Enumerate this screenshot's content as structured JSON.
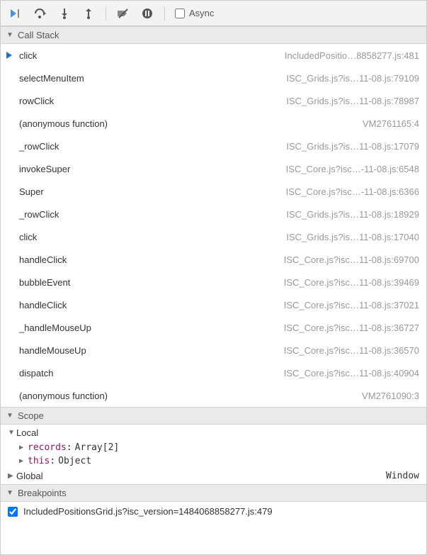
{
  "toolbar": {
    "async_label": "Async",
    "async_checked": false
  },
  "sections": {
    "callstack_title": "Call Stack",
    "scope_title": "Scope",
    "breakpoints_title": "Breakpoints"
  },
  "callstack": [
    {
      "func": "click",
      "loc": "IncludedPositio…8858277.js:481",
      "active": true
    },
    {
      "func": "selectMenuItem",
      "loc": "ISC_Grids.js?is…11-08.js:79109"
    },
    {
      "func": "rowClick",
      "loc": "ISC_Grids.js?is…11-08.js:78987"
    },
    {
      "func": "(anonymous function)",
      "loc": "VM2761165:4"
    },
    {
      "func": "_rowClick",
      "loc": "ISC_Grids.js?is…11-08.js:17079"
    },
    {
      "func": "invokeSuper",
      "loc": "ISC_Core.js?isc…-11-08.js:6548"
    },
    {
      "func": "Super",
      "loc": "ISC_Core.js?isc…-11-08.js:6366"
    },
    {
      "func": "_rowClick",
      "loc": "ISC_Grids.js?is…11-08.js:18929"
    },
    {
      "func": "click",
      "loc": "ISC_Grids.js?is…11-08.js:17040"
    },
    {
      "func": "handleClick",
      "loc": "ISC_Core.js?isc…11-08.js:69700"
    },
    {
      "func": "bubbleEvent",
      "loc": "ISC_Core.js?isc…11-08.js:39469"
    },
    {
      "func": "handleClick",
      "loc": "ISC_Core.js?isc…11-08.js:37021"
    },
    {
      "func": "_handleMouseUp",
      "loc": "ISC_Core.js?isc…11-08.js:36727"
    },
    {
      "func": "handleMouseUp",
      "loc": "ISC_Core.js?isc…11-08.js:36570"
    },
    {
      "func": "dispatch",
      "loc": "ISC_Core.js?isc…11-08.js:40904"
    },
    {
      "func": "(anonymous function)",
      "loc": "VM2761090:3"
    }
  ],
  "scope": {
    "local_label": "Local",
    "locals": [
      {
        "name": "records",
        "type": "Array[2]"
      },
      {
        "name": "this",
        "type": "Object"
      }
    ],
    "global_label": "Global",
    "global_type": "Window"
  },
  "breakpoints": [
    {
      "label": "IncludedPositionsGrid.js?isc_version=1484068858277.js:479",
      "checked": true
    }
  ]
}
